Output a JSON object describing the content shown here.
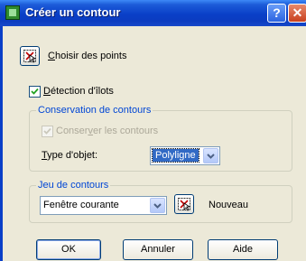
{
  "window": {
    "title": "Créer un contour",
    "help_label": "?",
    "close_label": "✕"
  },
  "pick_points": {
    "label": "Choisir des points",
    "mnemonic": "C",
    "rest": "hoisir des points"
  },
  "island_detection": {
    "label": "Détection d'îlots",
    "mnemonic": "D",
    "rest": "étection d'îlots",
    "checked": true
  },
  "boundary_retention": {
    "legend": "Conservation de contours",
    "retain_label": "Conserver les contours",
    "retain_pre": "Conser",
    "retain_mnemonic": "v",
    "retain_post": "er les contours",
    "retain_checked": true,
    "retain_enabled": false,
    "object_type_label": "Type d'objet:",
    "object_type_mnemonic": "T",
    "object_type_rest": "ype d'objet:",
    "object_type_value": "Polyligne"
  },
  "boundary_set": {
    "legend": "Jeu de contours",
    "value": "Fenêtre courante",
    "new_label": "Nouveau"
  },
  "buttons": {
    "ok": "OK",
    "cancel": "Annuler",
    "help": "Aide"
  },
  "icons": [
    "app-icon",
    "help-icon",
    "close-icon",
    "pick-points-icon",
    "check-icon",
    "chevron-down-icon",
    "new-boundary-icon"
  ]
}
